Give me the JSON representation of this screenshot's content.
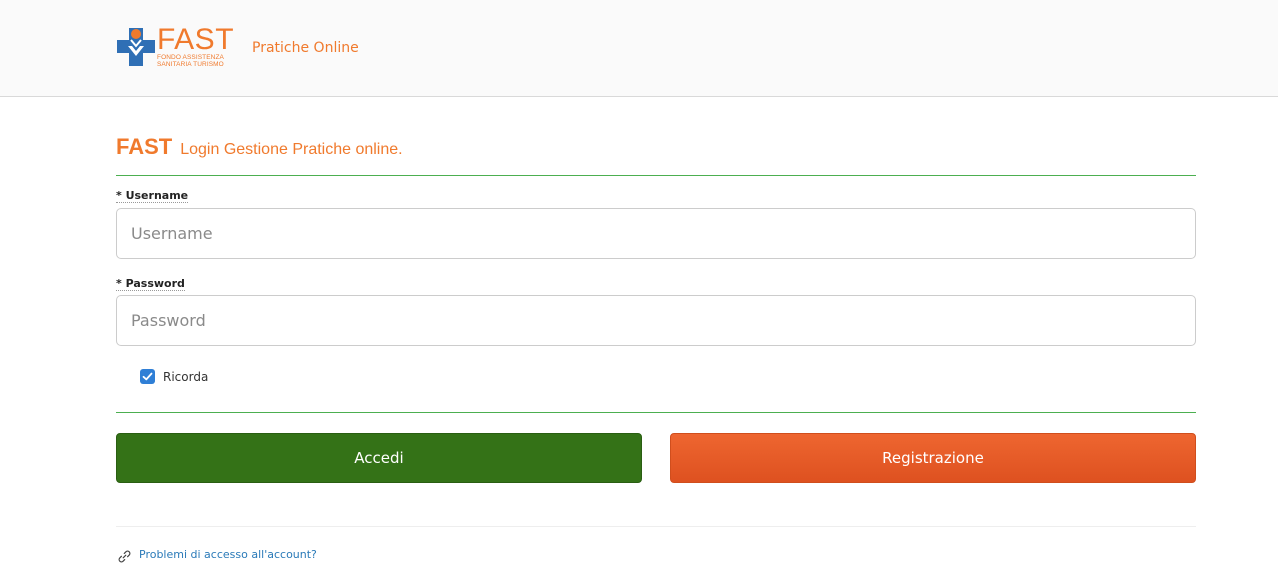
{
  "header": {
    "logo_text": "FAST",
    "logo_subtitle_line1": "FONDO ASSISTENZA",
    "logo_subtitle_line2": "SANITARIA TURISMO",
    "title": "Pratiche Online"
  },
  "login": {
    "heading_brand": "FAST",
    "heading_text": "Login Gestione Pratiche online.",
    "username": {
      "label": "* Username",
      "placeholder": "Username",
      "value": ""
    },
    "password": {
      "label": "* Password",
      "placeholder": "Password",
      "value": ""
    },
    "remember": {
      "label": "Ricorda",
      "checked": true
    },
    "login_button": "Accedi",
    "register_button": "Registrazione",
    "help_link": "Problemi di accesso all'account?"
  },
  "colors": {
    "brand_orange": "#f07a2d",
    "logo_blue": "#2f6fb5",
    "divider_green": "#4caf50",
    "login_green": "#347217",
    "register_orange": "#e45a25",
    "link_blue": "#2a7ab8",
    "checkbox_blue": "#2f7fd6"
  },
  "icons": {
    "logo": "fast-cross-logo-icon",
    "checkbox": "check-icon",
    "help": "link-icon"
  }
}
